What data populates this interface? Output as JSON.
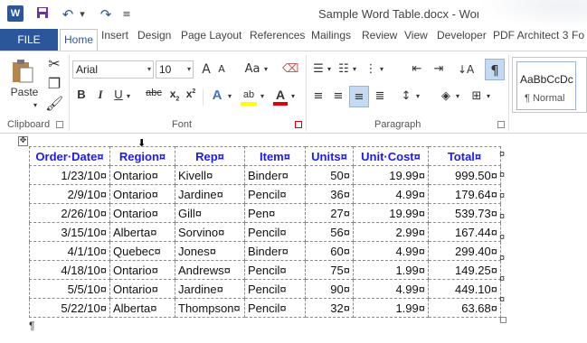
{
  "titlebar": {
    "app_logo": "W",
    "save_icon": "save-icon",
    "undo_icon": "undo-icon",
    "redo_icon": "redo-icon",
    "title": "Sample Word Table.docx - Word"
  },
  "tabs": {
    "file": "FILE",
    "items": [
      "Home",
      "Insert",
      "Design",
      "Page Layout",
      "References",
      "Mailings",
      "Review",
      "View",
      "Developer",
      "PDF Architect 3",
      "Fo"
    ]
  },
  "ribbon": {
    "clipboard": {
      "paste_label": "Paste",
      "group_label": "Clipboard"
    },
    "font": {
      "font_name": "Arial",
      "font_size": "10",
      "grow": "A",
      "shrink": "A",
      "case": "Aa",
      "bold": "B",
      "italic": "I",
      "underline": "U",
      "strike": "abc",
      "subscript": "x",
      "superscript": "x",
      "text_effect": "A",
      "highlight": "ab",
      "font_color": "A",
      "group_label": "Font"
    },
    "paragraph": {
      "group_label": "Paragraph",
      "pilcrow": "¶"
    },
    "styles": {
      "sample": "AaBbCcDc",
      "name": "¶ Normal"
    }
  },
  "table": {
    "headers": [
      "Order·Date¤",
      "Region¤",
      "Rep¤",
      "Item¤",
      "Units¤",
      "Unit·Cost¤",
      "Total¤"
    ],
    "rows": [
      [
        "1/23/10¤",
        "Ontario¤",
        "Kivell¤",
        "Binder¤",
        "50¤",
        "19.99¤",
        "999.50¤"
      ],
      [
        "2/9/10¤",
        "Ontario¤",
        "Jardine¤",
        "Pencil¤",
        "36¤",
        "4.99¤",
        "179.64¤"
      ],
      [
        "2/26/10¤",
        "Ontario¤",
        "Gill¤",
        "Pen¤",
        "27¤",
        "19.99¤",
        "539.73¤"
      ],
      [
        "3/15/10¤",
        "Alberta¤",
        "Sorvino¤",
        "Pencil¤",
        "56¤",
        "2.99¤",
        "167.44¤"
      ],
      [
        "4/1/10¤",
        "Quebec¤",
        "Jones¤",
        "Binder¤",
        "60¤",
        "4.99¤",
        "299.40¤"
      ],
      [
        "4/18/10¤",
        "Ontario¤",
        "Andrews¤",
        "Pencil¤",
        "75¤",
        "1.99¤",
        "149.25¤"
      ],
      [
        "5/5/10¤",
        "Ontario¤",
        "Jardine¤",
        "Pencil¤",
        "90¤",
        "4.99¤",
        "449.10¤"
      ],
      [
        "5/22/10¤",
        "Alberta¤",
        "Thompson¤",
        "Pencil¤",
        "32¤",
        "1.99¤",
        "63.68¤"
      ]
    ],
    "row_end_mark": "¤",
    "paragraph_mark": "¶"
  },
  "colors": {
    "accent": "#2b579a",
    "header_text": "#1a1aff"
  }
}
